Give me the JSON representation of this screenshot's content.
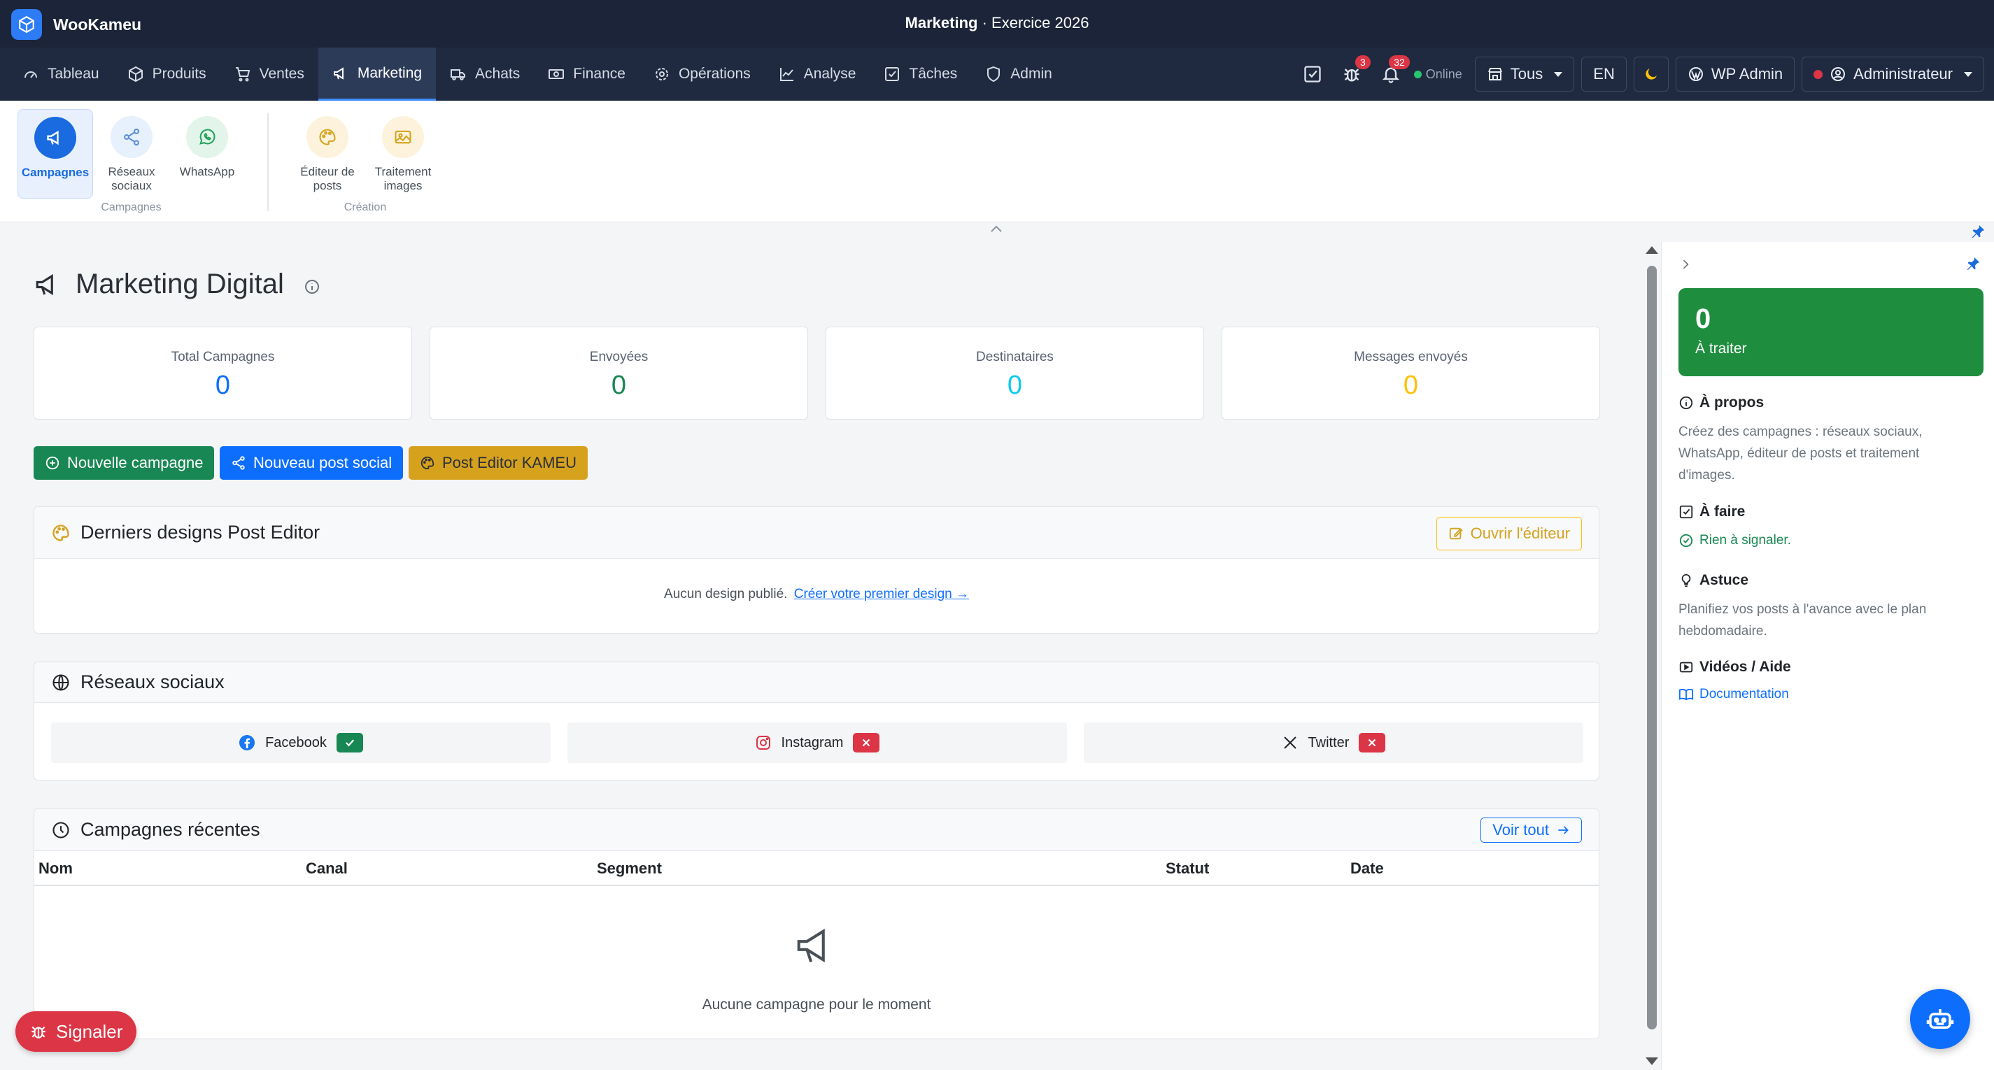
{
  "app": {
    "name": "WooKameu",
    "module": "Marketing",
    "separator": " · ",
    "fiscal_year": "Exercice 2026"
  },
  "nav": {
    "items": [
      {
        "label": "Tableau",
        "icon": "speedometer-icon"
      },
      {
        "label": "Produits",
        "icon": "box-icon"
      },
      {
        "label": "Ventes",
        "icon": "cart-icon"
      },
      {
        "label": "Marketing",
        "icon": "megaphone-icon",
        "active": true
      },
      {
        "label": "Achats",
        "icon": "truck-icon"
      },
      {
        "label": "Finance",
        "icon": "cash-icon"
      },
      {
        "label": "Opérations",
        "icon": "gear-icon"
      },
      {
        "label": "Analyse",
        "icon": "chart-icon"
      },
      {
        "label": "Tâches",
        "icon": "checkbox-icon"
      },
      {
        "label": "Admin",
        "icon": "shield-icon"
      }
    ],
    "bug_badge": "3",
    "notif_badge": "32",
    "status": "Online",
    "store_select": "Tous",
    "lang": "EN",
    "wp_admin": "WP Admin",
    "user": "Administrateur"
  },
  "ribbon": {
    "campagnes_group": "Campagnes",
    "creation_group": "Création",
    "items": {
      "campagnes": "Campagnes",
      "reseaux_1": "Réseaux",
      "reseaux_2": "sociaux",
      "whatsapp": "WhatsApp",
      "editeur_1": "Éditeur de",
      "editeur_2": "posts",
      "traitement_1": "Traitement",
      "traitement_2": "images"
    }
  },
  "page": {
    "title": "Marketing Digital",
    "stats": [
      {
        "label": "Total Campagnes",
        "value": "0",
        "color": "#0d6efd"
      },
      {
        "label": "Envoyées",
        "value": "0",
        "color": "#198754"
      },
      {
        "label": "Destinataires",
        "value": "0",
        "color": "#0dcaf0"
      },
      {
        "label": "Messages envoyés",
        "value": "0",
        "color": "#ffc107"
      }
    ],
    "actions": {
      "new_campaign": "Nouvelle campagne",
      "new_social_post": "Nouveau post social",
      "post_editor": "Post Editor KAMEU"
    },
    "designs": {
      "title": "Derniers designs Post Editor",
      "open_editor": "Ouvrir l'éditeur",
      "empty_text": "Aucun design publié.",
      "empty_link": "Créer votre premier design →"
    },
    "social": {
      "title": "Réseaux sociaux",
      "networks": [
        {
          "name": "Facebook",
          "connected": true
        },
        {
          "name": "Instagram",
          "connected": false
        },
        {
          "name": "Twitter",
          "connected": false
        }
      ]
    },
    "recent": {
      "title": "Campagnes récentes",
      "view_all": "Voir tout",
      "columns": [
        "Nom",
        "Canal",
        "Segment",
        "Statut",
        "Date"
      ],
      "empty": "Aucune campagne pour le moment"
    }
  },
  "right_panel": {
    "todo_count": "0",
    "todo_label": "À traiter",
    "about_title": "À propos",
    "about_text": "Créez des campagnes : réseaux sociaux, WhatsApp, éditeur de posts et traitement d'images.",
    "todo_title": "À faire",
    "todo_text": "Rien à signaler.",
    "tip_title": "Astuce",
    "tip_text": "Planifiez vos posts à l'avance avec le plan hebdomadaire.",
    "videos_title": "Vidéos / Aide",
    "docs_link": "Documentation"
  },
  "floating": {
    "signaler": "Signaler"
  }
}
